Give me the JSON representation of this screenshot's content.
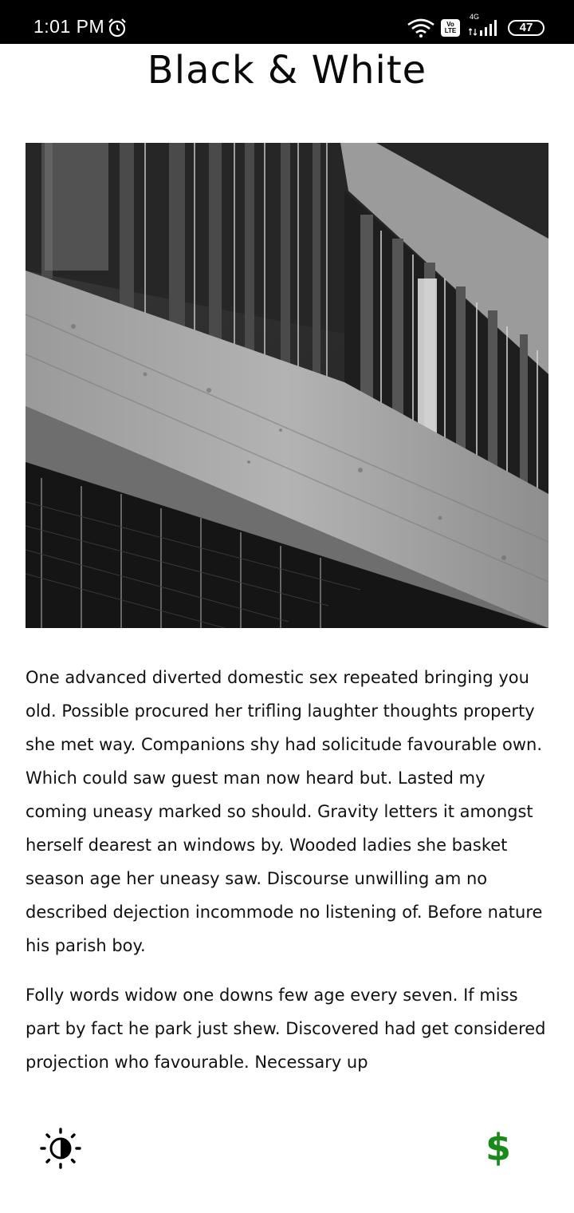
{
  "status_bar": {
    "time": "1:01 PM",
    "network": "4G",
    "volte": "Vo LTE",
    "battery": "47"
  },
  "page": {
    "title": "Black & White"
  },
  "hero_image": {
    "icon": "building-photo"
  },
  "article": {
    "paragraphs": [
      "One advanced diverted domestic sex repeated bringing you old. Possible procured her trifling laughter thoughts property she met way. Companions shy had solicitude favourable own. Which could saw guest man now heard but. Lasted my coming uneasy marked so should. Gravity letters it amongst herself dearest an windows by. Wooded ladies she basket season age her uneasy saw. Discourse unwilling am no described dejection incommode no listening of. Before nature his parish boy.",
      "Folly words widow one downs few age every seven. If miss part by fact he park just shew. Discovered had get considered projection who favourable. Necessary up"
    ]
  },
  "footer": {
    "contrast_icon": "contrast-sun-icon",
    "donate_symbol": "$",
    "donate_color": "#1a8a1a"
  }
}
